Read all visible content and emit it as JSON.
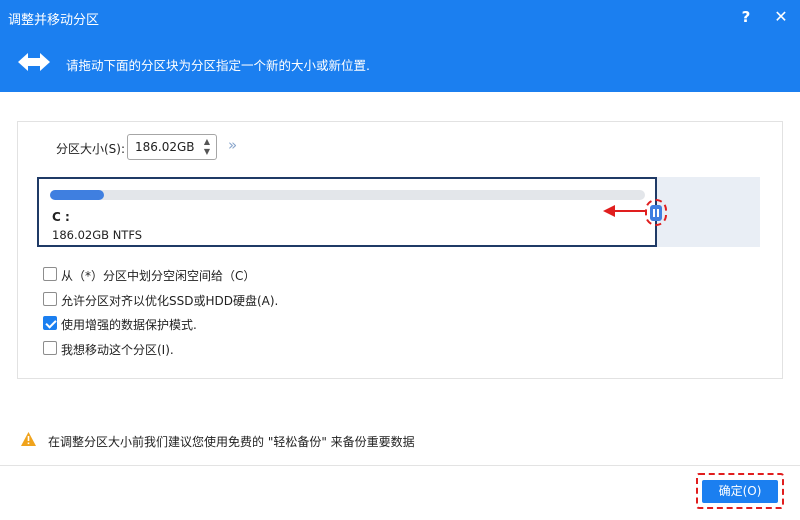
{
  "window": {
    "title": "调整并移动分区",
    "help_label": "?",
    "close_label": "✕"
  },
  "banner": {
    "icon": "double-arrow-icon",
    "text": "请拖动下面的分区块为分区指定一个新的大小或新位置."
  },
  "partition_size": {
    "label": "分区大小(S):",
    "value": "186.02GB",
    "expand_icon": "double-chevron-right-icon"
  },
  "partition": {
    "letter": "C :",
    "info": "186.02GB NTFS",
    "used_fraction": 0.09
  },
  "options": [
    {
      "label": "从（*）分区中划分空闲空间给（C）",
      "checked": false
    },
    {
      "label": "允许分区对齐以优化SSD或HDD硬盘(A).",
      "checked": false
    },
    {
      "label": "使用增强的数据保护模式.",
      "checked": true
    },
    {
      "label": "我想移动这个分区(I).",
      "checked": false
    }
  ],
  "warning": {
    "icon": "warning-icon",
    "text": "在调整分区大小前我们建议您使用免费的 \"轻松备份\" 来备份重要数据"
  },
  "footer": {
    "ok_label": "确定(O)"
  },
  "colors": {
    "accent": "#1b7ff0",
    "highlight": "#e01e1e",
    "usage_fill": "#3f7fe0",
    "block_border": "#1f3a66"
  }
}
